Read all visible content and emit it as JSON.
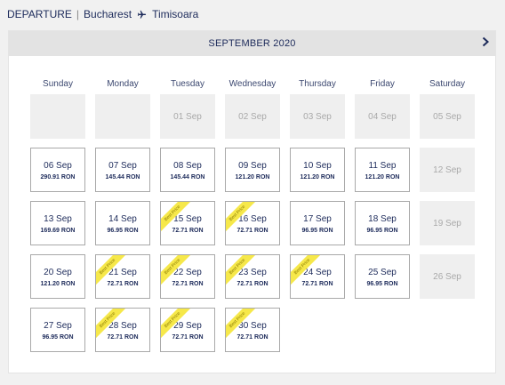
{
  "header": {
    "departure_label": "DEPARTURE",
    "origin": "Bucharest",
    "destination": "Timisoara"
  },
  "calendar": {
    "month_title": "SEPTEMBER 2020",
    "weekdays": [
      "Sunday",
      "Monday",
      "Tuesday",
      "Wednesday",
      "Thursday",
      "Friday",
      "Saturday"
    ],
    "promo_label": "Best Price",
    "weeks": [
      [
        {
          "empty": true
        },
        {
          "empty": true
        },
        {
          "date": "01 Sep",
          "available": false
        },
        {
          "date": "02 Sep",
          "available": false
        },
        {
          "date": "03 Sep",
          "available": false
        },
        {
          "date": "04 Sep",
          "available": false
        },
        {
          "date": "05 Sep",
          "available": false
        }
      ],
      [
        {
          "date": "06 Sep",
          "price": "290.91 RON",
          "available": true
        },
        {
          "date": "07 Sep",
          "price": "145.44 RON",
          "available": true
        },
        {
          "date": "08 Sep",
          "price": "145.44 RON",
          "available": true
        },
        {
          "date": "09 Sep",
          "price": "121.20 RON",
          "available": true
        },
        {
          "date": "10 Sep",
          "price": "121.20 RON",
          "available": true
        },
        {
          "date": "11 Sep",
          "price": "121.20 RON",
          "available": true
        },
        {
          "date": "12 Sep",
          "available": false
        }
      ],
      [
        {
          "date": "13 Sep",
          "price": "169.69 RON",
          "available": true
        },
        {
          "date": "14 Sep",
          "price": "96.95 RON",
          "available": true
        },
        {
          "date": "15 Sep",
          "price": "72.71 RON",
          "available": true,
          "promo": true
        },
        {
          "date": "16 Sep",
          "price": "72.71 RON",
          "available": true,
          "promo": true
        },
        {
          "date": "17 Sep",
          "price": "96.95 RON",
          "available": true
        },
        {
          "date": "18 Sep",
          "price": "96.95 RON",
          "available": true
        },
        {
          "date": "19 Sep",
          "available": false
        }
      ],
      [
        {
          "date": "20 Sep",
          "price": "121.20 RON",
          "available": true
        },
        {
          "date": "21 Sep",
          "price": "72.71 RON",
          "available": true,
          "promo": true
        },
        {
          "date": "22 Sep",
          "price": "72.71 RON",
          "available": true,
          "promo": true
        },
        {
          "date": "23 Sep",
          "price": "72.71 RON",
          "available": true,
          "promo": true
        },
        {
          "date": "24 Sep",
          "price": "72.71 RON",
          "available": true,
          "promo": true
        },
        {
          "date": "25 Sep",
          "price": "96.95 RON",
          "available": true
        },
        {
          "date": "26 Sep",
          "available": false
        }
      ],
      [
        {
          "date": "27 Sep",
          "price": "96.95 RON",
          "available": true
        },
        {
          "date": "28 Sep",
          "price": "72.71 RON",
          "available": true,
          "promo": true
        },
        {
          "date": "29 Sep",
          "price": "72.71 RON",
          "available": true,
          "promo": true
        },
        {
          "date": "30 Sep",
          "price": "72.71 RON",
          "available": true,
          "promo": true
        }
      ]
    ]
  },
  "icons": {
    "route": "airplane-icon",
    "next": "chevron-right-icon"
  },
  "colors": {
    "text": "#1c2a5a",
    "promo": "#f6e84a",
    "unavailable_bg": "#efefef",
    "border": "#a9a9a9"
  }
}
